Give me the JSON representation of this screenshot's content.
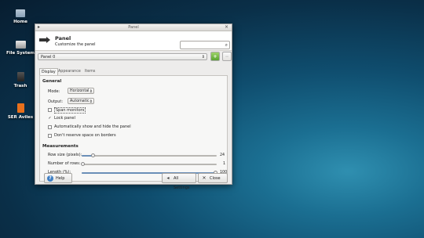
{
  "desktop": {
    "icons": [
      {
        "label": "Home",
        "icon": "folder-icon"
      },
      {
        "label": "File System",
        "icon": "drive-icon"
      },
      {
        "label": "Trash",
        "icon": "trash-icon"
      },
      {
        "label": "SER Aviles",
        "icon": "document-icon"
      }
    ]
  },
  "window": {
    "title": "Panel",
    "header_title": "Panel",
    "header_subtitle": "Customize the panel",
    "search_placeholder": "",
    "panel_select": "Panel 0",
    "tabs": [
      "Display",
      "Appearance",
      "Items"
    ],
    "general": {
      "heading": "General",
      "mode_label": "Mode:",
      "mode_value": "Horizontal",
      "output_label": "Output:",
      "output_value": "Automatic",
      "span_monitors": "Span monitors",
      "lock_panel": "Lock panel",
      "autohide": "Automatically show and hide the panel",
      "no_reserve": "Don't reserve space on borders"
    },
    "measurements": {
      "heading": "Measurements",
      "row_size_label": "Row size (pixels):",
      "row_size_value": "24",
      "rows_label": "Number of rows:",
      "rows_value": "1",
      "length_label": "Length (%):",
      "length_value": "100"
    },
    "checks": {
      "span_monitors": false,
      "lock_panel": true,
      "autohide": false,
      "no_reserve": false
    },
    "buttons": {
      "help": "Help",
      "all_settings": "All Settings",
      "close": "Close"
    }
  }
}
